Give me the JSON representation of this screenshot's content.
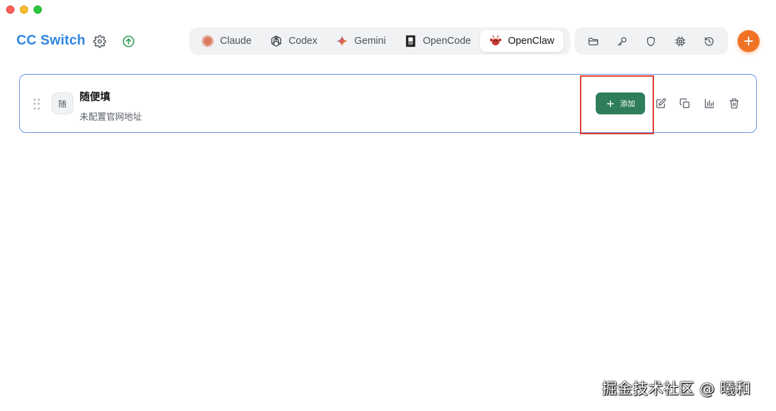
{
  "app": {
    "title": "CC Switch"
  },
  "tabs": [
    {
      "label": "Claude",
      "icon": "claude-icon"
    },
    {
      "label": "Codex",
      "icon": "codex-icon"
    },
    {
      "label": "Gemini",
      "icon": "gemini-icon"
    },
    {
      "label": "OpenCode",
      "icon": "opencode-icon"
    },
    {
      "label": "OpenClaw",
      "icon": "openclaw-icon",
      "active": true
    }
  ],
  "toolbar": {
    "icons": [
      "folder-icon",
      "key-icon",
      "shield-icon",
      "chip-icon",
      "history-icon"
    ]
  },
  "provider": {
    "avatar_text": "随",
    "name": "随便填",
    "subtitle": "未配置官网地址",
    "add_label": "添加"
  },
  "watermark": "掘金技术社区 @ 曦和",
  "colors": {
    "brand": "#2f86e0",
    "add_button": "#2e7d5b",
    "fab": "#f07325",
    "card_border": "#5b95db",
    "highlight": "#e23a30"
  }
}
